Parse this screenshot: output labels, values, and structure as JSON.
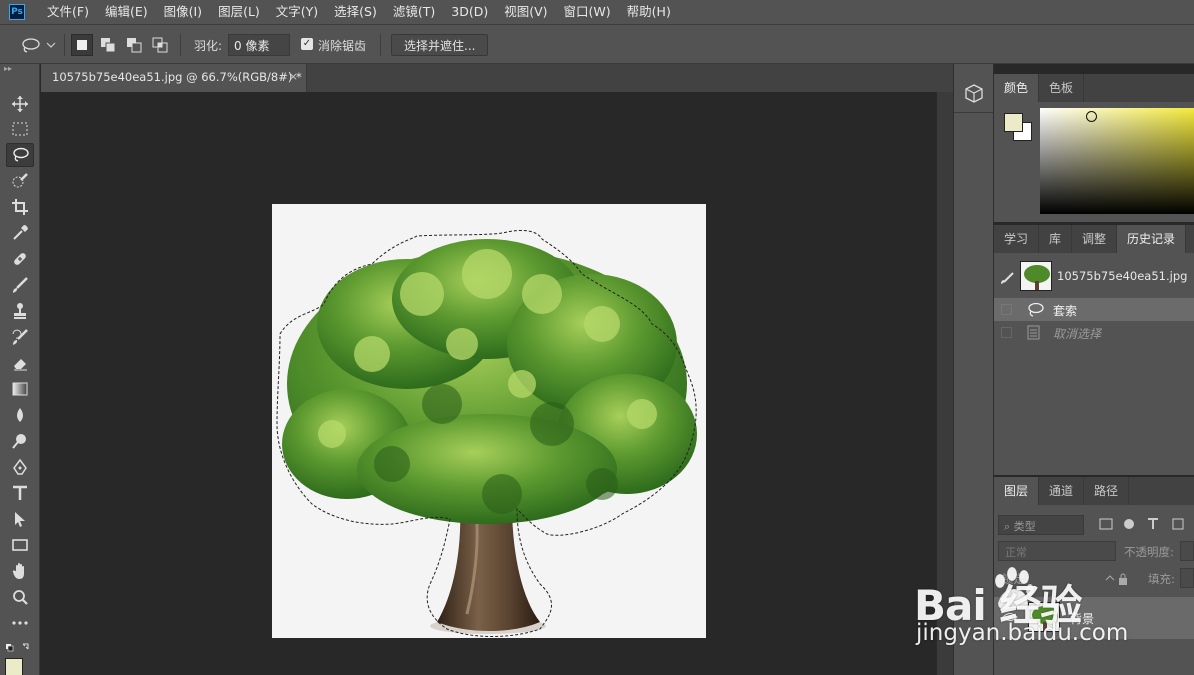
{
  "app": {
    "logo": "Ps"
  },
  "menu": [
    "文件(F)",
    "编辑(E)",
    "图像(I)",
    "图层(L)",
    "文字(Y)",
    "选择(S)",
    "滤镜(T)",
    "3D(D)",
    "视图(V)",
    "窗口(W)",
    "帮助(H)"
  ],
  "options": {
    "feather_label": "羽化:",
    "feather_value": "0 像素",
    "antialias_label": "消除锯齿",
    "antialias_checked": true,
    "select_mask_button": "选择并遮住..."
  },
  "document": {
    "tab_title": "10575b75e40ea51.jpg @ 66.7%(RGB/8#) *",
    "close": "×"
  },
  "colors": {
    "foreground": "#ecebc8",
    "background": "#ffffff",
    "accent": "#31a8ff"
  },
  "color_panel": {
    "tabs": [
      "颜色",
      "色板"
    ],
    "active_tab": "颜色"
  },
  "history_panel": {
    "tabs": [
      "学习",
      "库",
      "调整",
      "历史记录"
    ],
    "active_tab": "历史记录",
    "snapshot_name": "10575b75e40ea51.jpg",
    "steps": [
      {
        "label": "套索",
        "state": "active"
      },
      {
        "label": "取消选择",
        "state": "undone"
      }
    ]
  },
  "layers_panel": {
    "tabs": [
      "图层",
      "通道",
      "路径"
    ],
    "active_tab": "图层",
    "filter_placeholder": "类型",
    "blend_mode": "正常",
    "opacity_label": "不透明度:",
    "lock_label": "锁定:",
    "fill_label": "填充:",
    "layer_name": "背景"
  },
  "watermark": {
    "logo": "Bai 经验",
    "url": "jingyan.baidu.com"
  },
  "icons": [
    "lasso-icon",
    "move-icon",
    "marquee-icon",
    "quick-select-icon",
    "crop-icon",
    "eyedropper-icon",
    "healing-icon",
    "brush-icon",
    "stamp-icon",
    "history-brush-icon",
    "eraser-icon",
    "gradient-icon",
    "blur-icon",
    "dodge-icon",
    "pen-icon",
    "type-icon",
    "path-select-icon",
    "rectangle-icon",
    "hand-icon",
    "zoom-icon",
    "more-icon"
  ]
}
